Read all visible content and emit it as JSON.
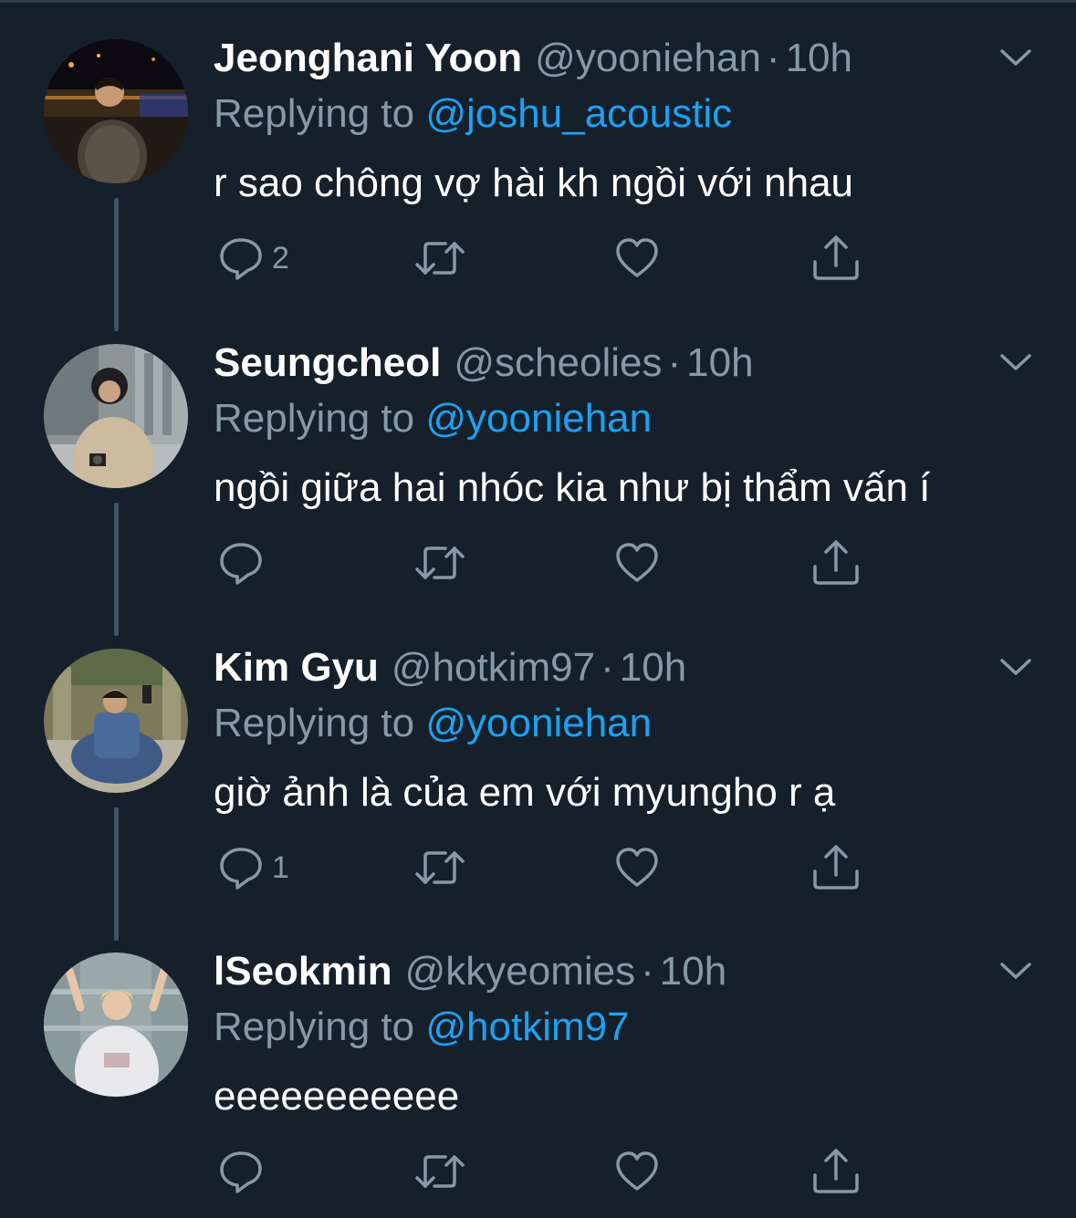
{
  "colors": {
    "background": "#15202b",
    "primary_text": "#ffffff",
    "secondary_text": "#8899a6",
    "link": "#1da1f2",
    "thread_line": "#3d5466"
  },
  "icons": {
    "reply": "reply-bubble-icon",
    "retweet": "retweet-arrows-icon",
    "like": "heart-icon",
    "share": "share-upload-icon",
    "caret": "chevron-down-icon"
  },
  "tweets": [
    {
      "name": "Jeonghani Yoon",
      "handle": "@yooniehan",
      "dot": "·",
      "time": "10h",
      "reply_prefix": "Replying to",
      "reply_to": "@joshu_acoustic",
      "text": "r sao chông vợ hài kh ngồi với nhau",
      "reply_count": "2"
    },
    {
      "name": "Seungcheol",
      "handle": "@scheolies",
      "dot": "·",
      "time": "10h",
      "reply_prefix": "Replying to",
      "reply_to": "@yooniehan",
      "text": "ngồi giữa hai nhóc kia như bị thẩm vấn í",
      "reply_count": ""
    },
    {
      "name": "Kim Gyu",
      "handle": "@hotkim97",
      "dot": "·",
      "time": "10h",
      "reply_prefix": "Replying to",
      "reply_to": "@yooniehan",
      "text": "giờ ảnh là của em với myungho r ạ",
      "reply_count": "1"
    },
    {
      "name": "lSeokmin",
      "handle": "@kkyeomies",
      "dot": "·",
      "time": "10h",
      "reply_prefix": "Replying to",
      "reply_to": "@hotkim97",
      "text": "eeeeeeeeeee",
      "reply_count": ""
    }
  ]
}
